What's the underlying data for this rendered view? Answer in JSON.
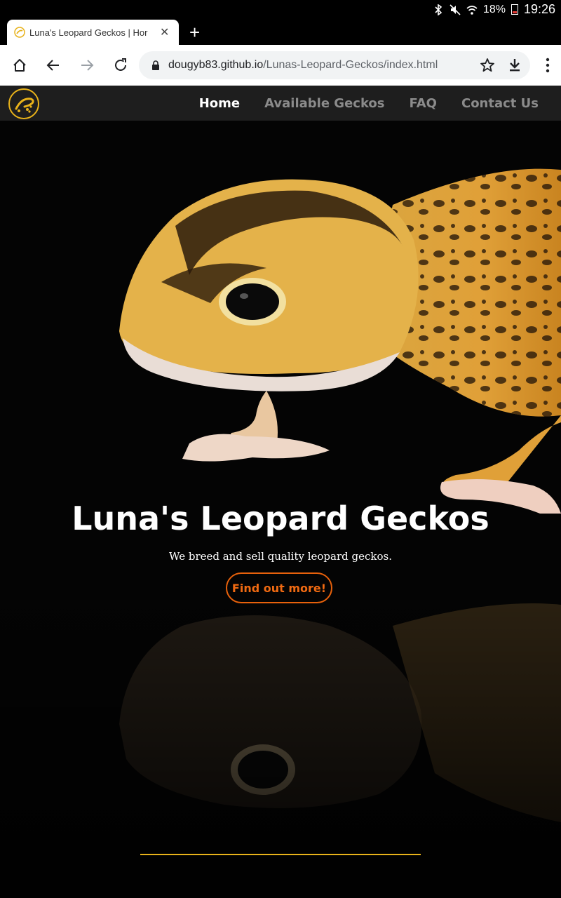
{
  "status_bar": {
    "battery": "18%",
    "time": "19:26",
    "icons": [
      "bluetooth-icon",
      "mute-icon",
      "wifi-icon",
      "battery-icon"
    ]
  },
  "browser": {
    "tab_title": "Luna's Leopard Geckos | Hor",
    "url_host": "dougyb83.github.io",
    "url_path": "/Lunas-Leopard-Geckos/index.html"
  },
  "site": {
    "nav": [
      {
        "label": "Home",
        "active": true
      },
      {
        "label": "Available Geckos",
        "active": false
      },
      {
        "label": "FAQ",
        "active": false
      },
      {
        "label": "Contact Us",
        "active": false
      }
    ],
    "hero": {
      "title": "Luna's Leopard Geckos",
      "subtitle": "We breed and sell quality leopard geckos.",
      "cta": "Find out more!"
    }
  },
  "colors": {
    "accent": "#e8610b",
    "logo_yellow": "#e8b21a",
    "nav_bg": "#1e1e1e"
  }
}
